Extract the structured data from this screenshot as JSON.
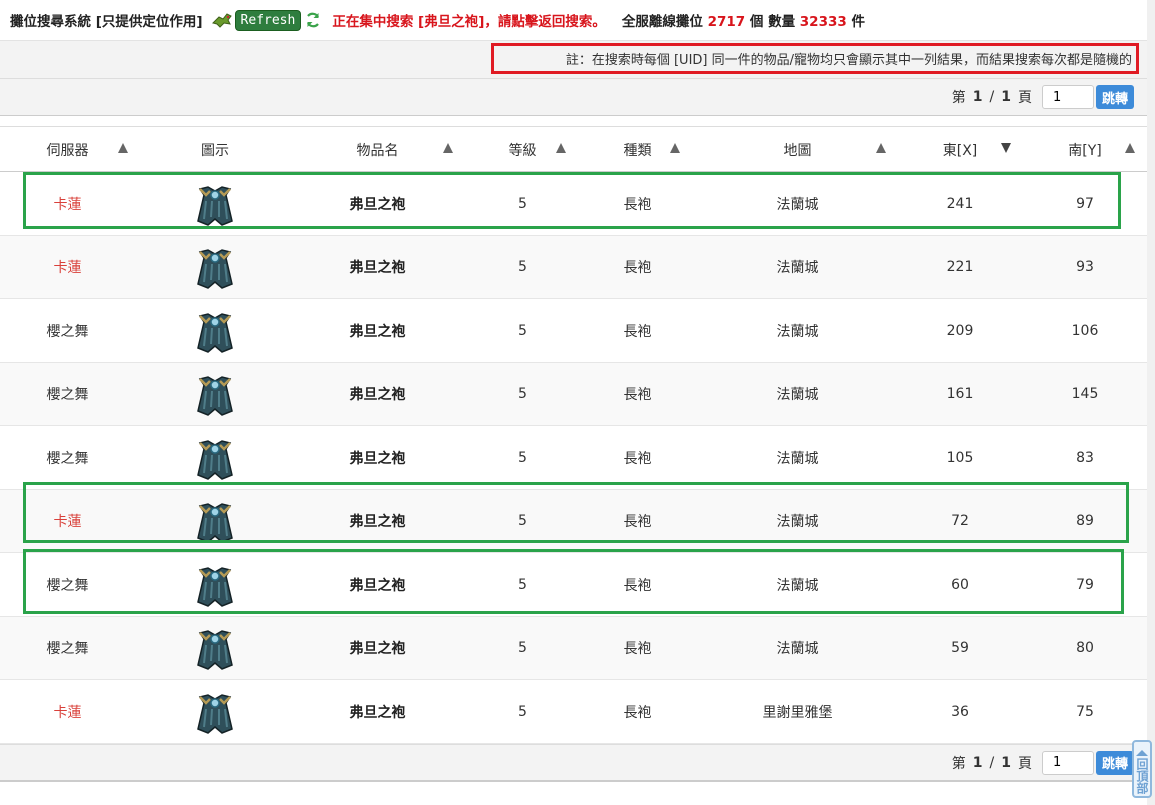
{
  "header": {
    "title": "攤位搜尋系統 [只提供定位作用]",
    "refresh_label": "Refresh",
    "status": "正在集中搜索 [弗旦之袍]，請點擊返回搜索。",
    "stats_prefix": "全服離線攤位",
    "stalls_count": "2717",
    "stats_mid": "個 數量",
    "item_count": "32333",
    "stats_suffix": "件"
  },
  "note": "註：在搜索時每個 [UID] 同一件的物品/寵物均只會顯示其中一列結果，而結果搜索每次都是隨機的",
  "pagination": {
    "prefix": "第",
    "current": "1",
    "sep": "/",
    "total": "1",
    "suffix": "頁",
    "input_value": "1",
    "jump_label": "跳轉"
  },
  "columns": [
    "伺服器",
    "圖示",
    "物品名",
    "等級",
    "種類",
    "地圖",
    "東[X]",
    "南[Y]"
  ],
  "rows": [
    {
      "server": "卡蓮",
      "name": "弗旦之袍",
      "level": "5",
      "type": "長袍",
      "map": "法蘭城",
      "x": "241",
      "y": "97"
    },
    {
      "server": "卡蓮",
      "name": "弗旦之袍",
      "level": "5",
      "type": "長袍",
      "map": "法蘭城",
      "x": "221",
      "y": "93"
    },
    {
      "server": "櫻之舞",
      "name": "弗旦之袍",
      "level": "5",
      "type": "長袍",
      "map": "法蘭城",
      "x": "209",
      "y": "106"
    },
    {
      "server": "櫻之舞",
      "name": "弗旦之袍",
      "level": "5",
      "type": "長袍",
      "map": "法蘭城",
      "x": "161",
      "y": "145"
    },
    {
      "server": "櫻之舞",
      "name": "弗旦之袍",
      "level": "5",
      "type": "長袍",
      "map": "法蘭城",
      "x": "105",
      "y": "83"
    },
    {
      "server": "卡蓮",
      "name": "弗旦之袍",
      "level": "5",
      "type": "長袍",
      "map": "法蘭城",
      "x": "72",
      "y": "89"
    },
    {
      "server": "櫻之舞",
      "name": "弗旦之袍",
      "level": "5",
      "type": "長袍",
      "map": "法蘭城",
      "x": "60",
      "y": "79"
    },
    {
      "server": "櫻之舞",
      "name": "弗旦之袍",
      "level": "5",
      "type": "長袍",
      "map": "法蘭城",
      "x": "59",
      "y": "80"
    },
    {
      "server": "卡蓮",
      "name": "弗旦之袍",
      "level": "5",
      "type": "長袍",
      "map": "里謝里雅堡",
      "x": "36",
      "y": "75"
    }
  ],
  "back_to_top": "回頂部",
  "colors": {
    "red": "#d8151c",
    "green_highlight": "#2aa34a",
    "jump_blue": "#3d8bd9"
  }
}
